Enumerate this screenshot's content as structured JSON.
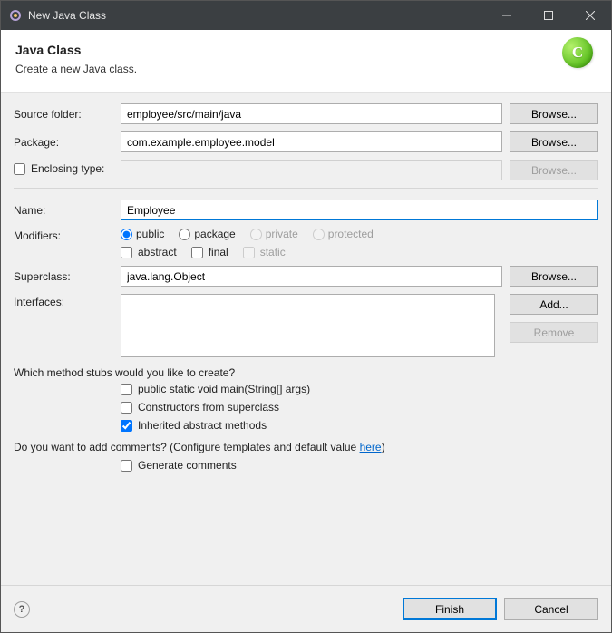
{
  "window": {
    "title": "New Java Class"
  },
  "header": {
    "title": "Java Class",
    "subtitle": "Create a new Java class.",
    "icon_letter": "C"
  },
  "labels": {
    "source_folder": "Source folder:",
    "package": "Package:",
    "enclosing_type": "Enclosing type:",
    "name": "Name:",
    "modifiers": "Modifiers:",
    "superclass": "Superclass:",
    "interfaces": "Interfaces:",
    "stubs_question": "Which method stubs would you like to create?",
    "comments_question": "Do you want to add comments? (Configure templates and default value ",
    "here": "here",
    "comments_question_end": ")"
  },
  "fields": {
    "source_folder": "employee/src/main/java",
    "package": "com.example.employee.model",
    "enclosing_type": "",
    "name": "Employee",
    "superclass": "java.lang.Object"
  },
  "buttons": {
    "browse": "Browse...",
    "add": "Add...",
    "remove": "Remove",
    "finish": "Finish",
    "cancel": "Cancel"
  },
  "modifiers": {
    "public": "public",
    "package": "package",
    "private": "private",
    "protected": "protected",
    "abstract": "abstract",
    "final": "final",
    "static": "static"
  },
  "stubs": {
    "main": "public static void main(String[] args)",
    "constructors": "Constructors from superclass",
    "inherited": "Inherited abstract methods"
  },
  "comments": {
    "generate": "Generate comments"
  }
}
